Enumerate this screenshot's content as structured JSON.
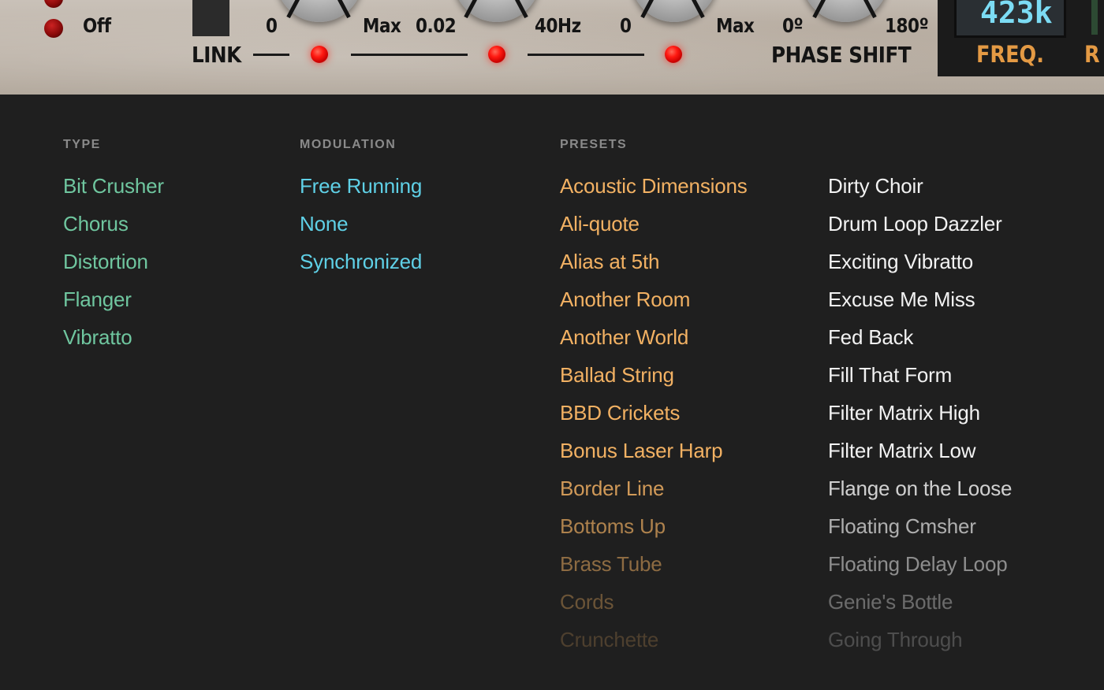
{
  "plugin": {
    "switch_off_label": "Off",
    "link_label": "LINK",
    "phase_shift_label": "PHASE SHIFT",
    "scale_labels": [
      "0",
      "Max",
      "0.02",
      "40Hz",
      "0",
      "Max",
      "0º",
      "180º"
    ],
    "display_value": "423k",
    "freq_label": "FREQ.",
    "second_display_label": "R"
  },
  "menu": {
    "type": {
      "heading": "TYPE",
      "color": "#6fc69f",
      "items": [
        "Bit Crusher",
        "Chorus",
        "Distortion",
        "Flanger",
        "Vibratto"
      ]
    },
    "modulation": {
      "heading": "MODULATION",
      "color": "#5fd0e6",
      "items": [
        "Free Running",
        "None",
        "Synchronized"
      ]
    },
    "presets": {
      "heading": "PRESETS",
      "color_a": "#f2b163",
      "color_b": "#f2f2f2",
      "column_a": [
        "Acoustic Dimensions",
        "Ali-quote",
        "Alias at 5th",
        "Another Room",
        "Another World",
        "Ballad String",
        "BBD Crickets",
        "Bonus Laser Harp",
        "Border Line",
        "Bottoms Up",
        "Brass Tube",
        "Cords",
        "Crunchette"
      ],
      "column_b": [
        "Dirty Choir",
        "Drum Loop Dazzler",
        "Exciting Vibratto",
        "Excuse Me Miss",
        "Fed Back",
        "Fill That Form",
        "Filter Matrix High",
        "Filter Matrix Low",
        "Flange on the Loose",
        "Floating Cmsher",
        "Floating Delay Loop",
        "Genie's Bottle",
        "Going Through"
      ]
    }
  }
}
